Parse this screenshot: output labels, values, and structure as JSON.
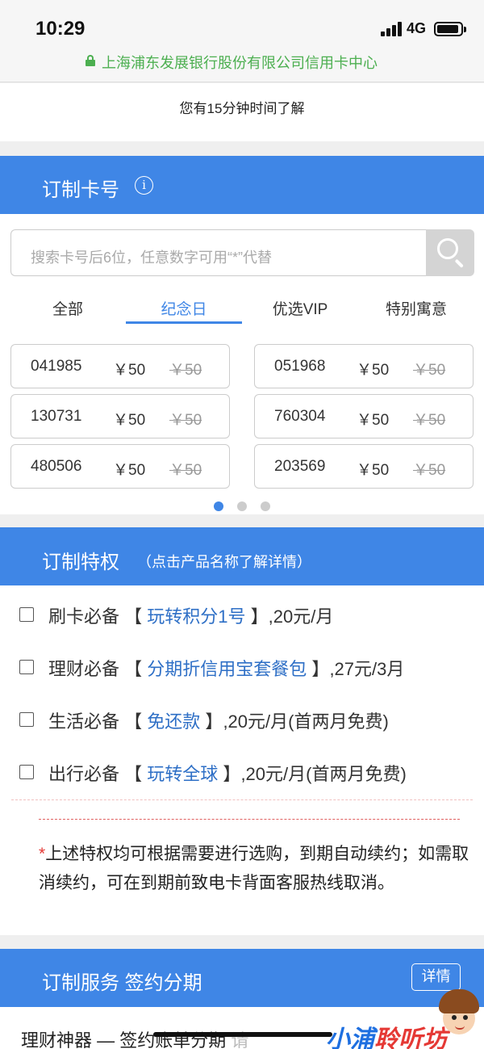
{
  "status_bar": {
    "time": "10:29",
    "network": "4G"
  },
  "browser": {
    "site_title": "上海浦东发展银行股份有限公司信用卡中心"
  },
  "notice": "您有15分钟时间了解",
  "custom_number": {
    "title": "订制卡号",
    "info_icon": "i",
    "search_placeholder": "搜索卡号后6位，任意数字可用“*”代替",
    "tabs": [
      "全部",
      "纪念日",
      "优选VIP",
      "特别寓意"
    ],
    "active_tab": "纪念日",
    "numbers": [
      {
        "number": "041985",
        "price": "￥50",
        "original_price": "￥50"
      },
      {
        "number": "051968",
        "price": "￥50",
        "original_price": "￥50"
      },
      {
        "number": "130731",
        "price": "￥50",
        "original_price": "￥50"
      },
      {
        "number": "760304",
        "price": "￥50",
        "original_price": "￥50"
      },
      {
        "number": "480506",
        "price": "￥50",
        "original_price": "￥50"
      },
      {
        "number": "203569",
        "price": "￥50",
        "original_price": "￥50"
      }
    ],
    "pagination": {
      "current": 1,
      "total": 3
    }
  },
  "privileges": {
    "title": "订制特权",
    "subtitle": "（点击产品名称了解详情）",
    "items": [
      {
        "category": "刷卡必备",
        "bracket_open": "【",
        "product": "玩转积分1号",
        "bracket_close": "】",
        "price": ",20元/月"
      },
      {
        "category": "理财必备",
        "bracket_open": "【",
        "product": "分期折信用宝套餐包",
        "bracket_close": "】",
        "price": ",27元/3月"
      },
      {
        "category": "生活必备",
        "bracket_open": "【",
        "product": "免还款",
        "bracket_close": "】",
        "price": ",20元/月(首两月免费)"
      },
      {
        "category": "出行必备",
        "bracket_open": "【",
        "product": "玩转全球",
        "bracket_close": "】",
        "price": ",20元/月(首两月免费)"
      }
    ],
    "note_star": "*",
    "note": "上述特权均可根据需要进行选购，到期自动续约；如需取消续约，可在到期前致电卡背面客服热线取消。"
  },
  "service": {
    "title": "订制服务 签约分期",
    "detail_button": "详情",
    "row_text": "理财神器 — 签约账单分期",
    "row_faded": "请"
  },
  "watermark": {
    "part1": "小浦",
    "part2": "聆听坊"
  },
  "colors": {
    "primary": "#3f86e6",
    "link": "#2e6fc6",
    "secure": "#4caf50",
    "alert": "#e53935"
  }
}
